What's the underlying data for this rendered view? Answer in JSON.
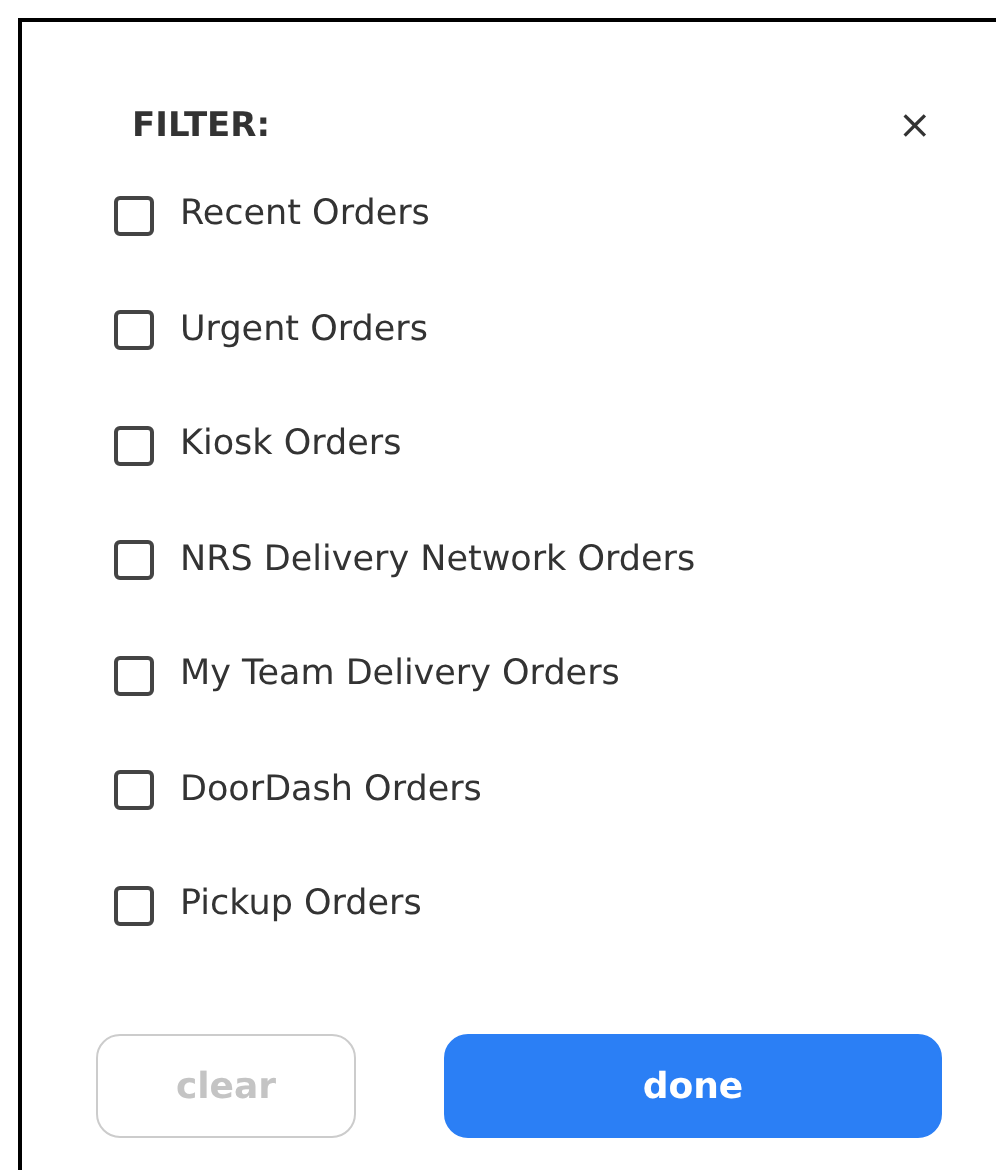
{
  "title": "FILTER:",
  "close": "×",
  "options": [
    {
      "label": "Recent Orders",
      "checked": false
    },
    {
      "label": "Urgent Orders",
      "checked": false
    },
    {
      "label": "Kiosk Orders",
      "checked": false
    },
    {
      "label": "NRS Delivery Network Orders",
      "checked": false
    },
    {
      "label": "My Team Delivery Orders",
      "checked": false
    },
    {
      "label": "DoorDash Orders",
      "checked": false
    },
    {
      "label": "Pickup Orders",
      "checked": false
    }
  ],
  "buttons": [
    {
      "label": "clear",
      "kind": "secondary",
      "disabled": true
    },
    {
      "label": "done",
      "kind": "primary",
      "disabled": false
    }
  ]
}
